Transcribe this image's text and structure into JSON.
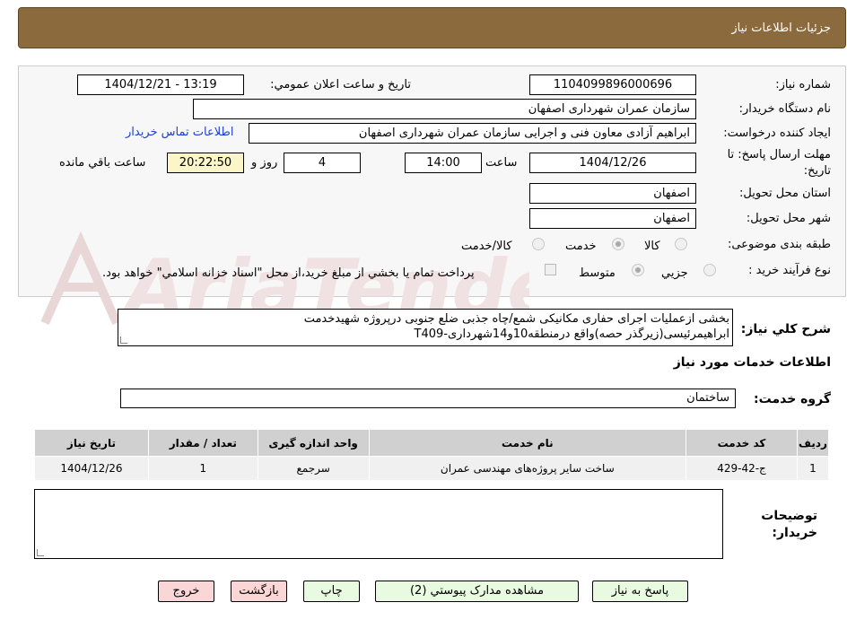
{
  "header": {
    "title": "جزئیات اطلاعات نیاز"
  },
  "form": {
    "need_number_label": "شماره نیاز:",
    "need_number": "1104099896000696",
    "announce_label": "تاریخ و ساعت اعلان عمومي:",
    "announce_value": "1404/12/21 - 13:19",
    "buyer_org_label": "نام دستگاه خريدار:",
    "buyer_org": "سازمان عمران شهرداری اصفهان",
    "requester_label": "ايجاد كننده درخواست:",
    "requester": "ابراهیم آزادی معاون فنی و اجرایی سازمان عمران شهرداری اصفهان",
    "contact_link": "اطلاعات تماس خريدار",
    "deadline_label_1": "مهلت ارسال پاسخ: تا",
    "deadline_label_2": "تاريخ:",
    "deadline_date": "1404/12/26",
    "time_label": "ساعت",
    "deadline_time": "14:00",
    "days_value": "4",
    "days_label": "روز و",
    "remaining_time": "20:22:50",
    "remaining_label": "ساعت باقي مانده",
    "province_label": "استان محل تحويل:",
    "province": "اصفهان",
    "city_label": "شهر محل تحويل:",
    "city": "اصفهان",
    "category_label": "طبقه بندی موضوعی:",
    "category_options": [
      "كالا",
      "خدمت",
      "كالا/خدمت"
    ],
    "category_selected": "خدمت",
    "process_label": "نوع فرآيند خريد :",
    "process_options": [
      "جزيي",
      "متوسط"
    ],
    "process_selected": "متوسط",
    "payment_note": "پرداخت تمام يا بخشي از مبلغ خريد،از محل \"اسناد خزانه اسلامي\" خواهد بود."
  },
  "description": {
    "label": "شرح كلي نياز:",
    "line1": "بخشی ازعملیات اجرای حفاری مکانیکی شمع/چاه جذبی ضلع جنوبی درپروژه شهیدخدمت",
    "line2": "ابراهیمرئیسی(زیرگذر حصه)واقع درمنطقه10و14شهرداری-T409"
  },
  "services": {
    "section_title": "اطلاعات خدمات مورد نياز",
    "group_label": "گروه خدمت:",
    "group_value": "ساختمان",
    "columns": [
      "رديف",
      "كد خدمت",
      "نام خدمت",
      "واحد اندازه گيری",
      "تعداد / مقدار",
      "تاريخ نياز"
    ],
    "rows": [
      [
        "1",
        "ج-42-429",
        "ساخت سایر پروژه‌های مهندسی عمران",
        "سرجمع",
        "1",
        "1404/12/26"
      ]
    ]
  },
  "buyer_notes": {
    "label_1": "توضيحات",
    "label_2": "خريدار:",
    "value": ""
  },
  "buttons": {
    "reply": "پاسخ به نياز",
    "attachments": "مشاهده مدارک پیوستي (2)",
    "print": "چاپ",
    "back": "بازگشت",
    "exit": "خروج"
  },
  "watermark_text": "AriaTender.neT",
  "colors": {
    "header_bg": "#8b6a3e",
    "link": "#1a3fd8",
    "button_green": "#e8fadf",
    "button_pink": "#fbd6d6",
    "remaining_bg": "#fcf5c7"
  }
}
